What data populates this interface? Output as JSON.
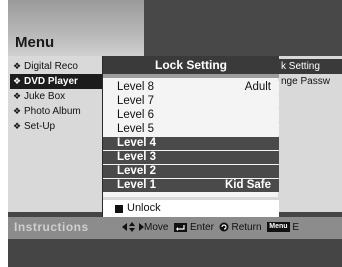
{
  "header": {
    "title": "Menu"
  },
  "left_menu": {
    "items": [
      {
        "label": "Digital Reco",
        "selected": false
      },
      {
        "label": "DVD Player",
        "selected": true
      },
      {
        "label": "Juke Box",
        "selected": false
      },
      {
        "label": "Photo Album",
        "selected": false
      },
      {
        "label": "Set-Up",
        "selected": false
      }
    ]
  },
  "right_menu": {
    "items": [
      {
        "label": "k Setting"
      },
      {
        "label": "nge Passw"
      }
    ]
  },
  "popup": {
    "title": "Lock Setting",
    "levels": [
      {
        "label": "Level 8",
        "tag": "Adult",
        "highlighted": false
      },
      {
        "label": "Level 7",
        "tag": "",
        "highlighted": false
      },
      {
        "label": "Level 6",
        "tag": "",
        "highlighted": false
      },
      {
        "label": "Level 5",
        "tag": "",
        "highlighted": false
      },
      {
        "label": "Level 4",
        "tag": "",
        "highlighted": true
      },
      {
        "label": "Level 3",
        "tag": "",
        "highlighted": true
      },
      {
        "label": "Level 2",
        "tag": "",
        "highlighted": true
      },
      {
        "label": "Level 1",
        "tag": "Kid Safe",
        "highlighted": true
      }
    ],
    "unlock_label": "Unlock"
  },
  "instructions": {
    "label": "Instructions",
    "move": "Move",
    "enter": "Enter",
    "return": "Return",
    "menu_key": "Menu",
    "exit_partial": "E"
  }
}
